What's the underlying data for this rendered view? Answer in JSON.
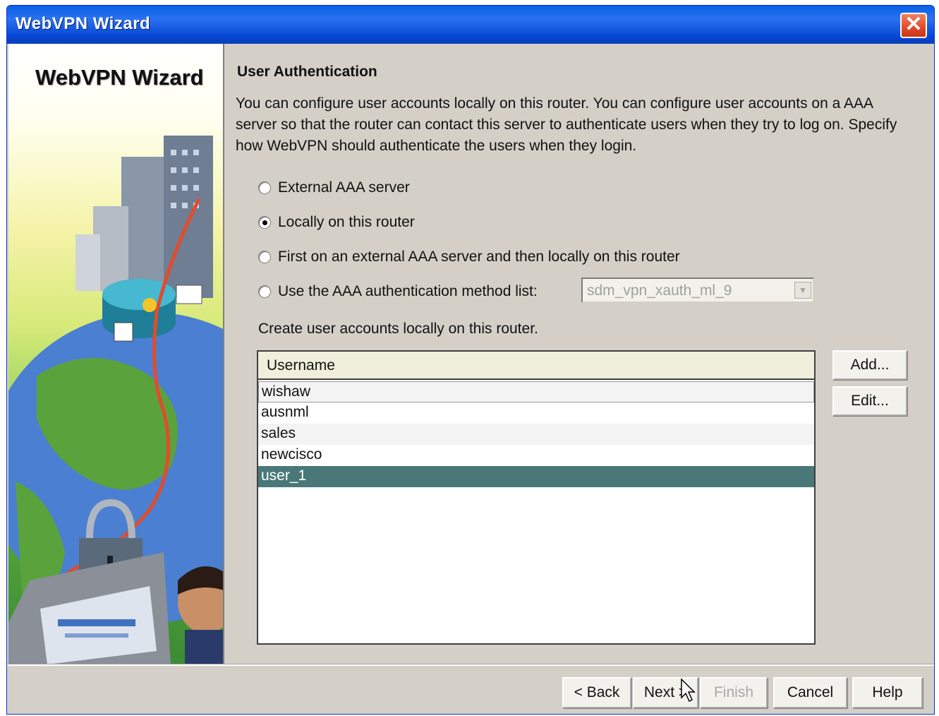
{
  "window": {
    "title": "WebVPN Wizard"
  },
  "side_panel": {
    "title": "WebVPN Wizard"
  },
  "page": {
    "heading": "User Authentication",
    "description": "You can configure user accounts locally on this router. You can configure user accounts on a AAA server so that the router can contact this server to authenticate users when they try to log on. Specify how WebVPN should authenticate the users when they login."
  },
  "auth_options": [
    {
      "label": "External AAA server",
      "checked": false
    },
    {
      "label": "Locally on this router",
      "checked": true
    },
    {
      "label": "First on an external AAA server and then locally on this router",
      "checked": false
    },
    {
      "label": "Use the AAA authentication method list:",
      "checked": false
    }
  ],
  "method_list": {
    "value": "sdm_vpn_xauth_ml_9",
    "enabled": false
  },
  "users": {
    "label": "Create user accounts locally on this router.",
    "column": "Username",
    "rows": [
      "wishaw",
      "ausnml",
      "sales",
      "newcisco",
      "user_1"
    ],
    "selected": "user_1",
    "add_label": "Add...",
    "edit_label": "Edit..."
  },
  "footer": {
    "back": "< Back",
    "next": "Next >",
    "finish": "Finish",
    "cancel": "Cancel",
    "help": "Help"
  },
  "colors": {
    "titlebar": "#0a5fe6",
    "selected_row": "#4a7878",
    "dialog_bg": "#d4d0c8"
  }
}
